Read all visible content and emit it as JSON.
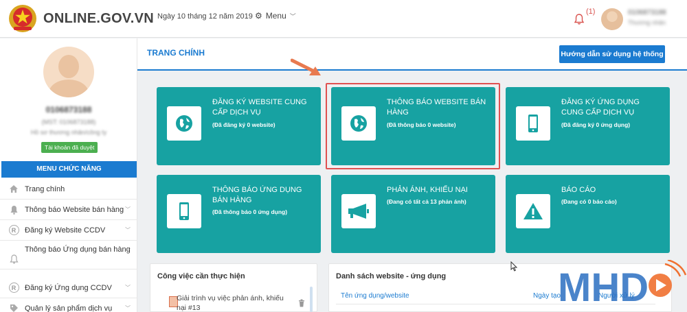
{
  "header": {
    "site_name": "ONLINE.GOV.VN",
    "date": "Ngày 10 tháng 12 năm 2019",
    "menu_label": "Menu",
    "notification_count": "(1)",
    "user_name": "0106873188",
    "user_role": "Thương nhân"
  },
  "sidebar": {
    "profile_id": "0106873188",
    "profile_mst": "(MST: 0106873188)",
    "profile_org": "Hồ sơ thương nhân/công ty",
    "verified_badge": "Tài khoản đã duyệt",
    "menu_header": "MENU CHỨC NĂNG",
    "items": [
      {
        "label": "Trang chính",
        "icon": "home-icon"
      },
      {
        "label": "Thông báo Website bán hàng",
        "icon": "bell-icon"
      },
      {
        "label": "Đăng ký Website CCDV",
        "icon": "registered-icon"
      },
      {
        "label": "Thông báo Ứng dụng bán hàng",
        "icon": "bell-outline-icon"
      },
      {
        "label": "Đăng ký Ứng dụng CCDV",
        "icon": "registered-icon"
      },
      {
        "label": "Quản lý sản phẩm dịch vụ",
        "icon": "tag-icon"
      }
    ]
  },
  "main": {
    "page_title": "TRANG CHÍNH",
    "guide_button": "Hướng dẫn sử dụng hệ thống",
    "tiles": [
      {
        "title": "ĐĂNG KÝ WEBSITE CUNG CẤP DỊCH VỤ",
        "sub": "(Đã đăng ký 0 website)",
        "icon": "globe-icon"
      },
      {
        "title": "THÔNG BÁO WEBSITE BÁN HÀNG",
        "sub": "(Đã thông báo 0 website)",
        "icon": "globe-icon"
      },
      {
        "title": "ĐĂNG KÝ ỨNG DỤNG CUNG CẤP DỊCH VỤ",
        "sub": "(Đã đăng ký 0 ứng dụng)",
        "icon": "mobile-icon"
      },
      {
        "title": "THÔNG BÁO ỨNG DỤNG BÁN HÀNG",
        "sub": "(Đã thông báo 0 ứng dụng)",
        "icon": "mobile-icon"
      },
      {
        "title": "PHẢN ÁNH, KHIẾU NẠI",
        "sub": "(Đang có tất cả 13 phản ánh)",
        "icon": "megaphone-icon"
      },
      {
        "title": "BÁO CÁO",
        "sub": "(Đang có 0 báo cáo)",
        "icon": "warning-icon"
      }
    ],
    "tasks_panel": {
      "title": "Công việc cần thực hiện",
      "items": [
        {
          "text": "Giải trình vụ việc phản ánh, khiếu nại #13"
        }
      ]
    },
    "list_panel": {
      "title": "Danh sách website - ứng dụng",
      "columns": [
        "Tên ứng dụng/website",
        "Ngày tạo",
        "Người xử lý"
      ]
    }
  },
  "watermark": {
    "text": "MHD"
  },
  "colors": {
    "accent": "#1b7bd0",
    "tile": "#17a2a2",
    "highlight": "#e05050",
    "badge": "#4caf50",
    "arrow": "#e87a50"
  }
}
